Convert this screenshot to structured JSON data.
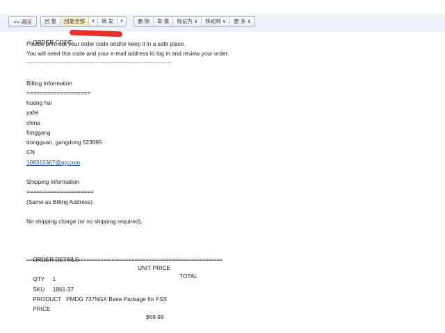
{
  "toolbar": {
    "back": "<< 返回",
    "reply": "回 复",
    "reply_all": "回复全部",
    "forward": "转 发",
    "delete": "删 除",
    "report": "举 报",
    "mark_as": "标记为",
    "move_to": "移动到",
    "more": "更 多",
    "dropdown_arrow": "∨"
  },
  "email": {
    "order_code_label": "ORDER CODE:",
    "instructions_1": "Please print out your order code and/or keep it in a safe place.",
    "instructions_2": "You will need this code and your e-mail address to log in and review your order.",
    "divider_dash": "-----------------------------------------------------------------------------------------------",
    "billing": {
      "heading": "Billing Information",
      "underline": "===================",
      "name": "huang hui",
      "line2": "yafei",
      "line3": "china",
      "line4": "fonggang",
      "city_line": "dongguan, gangdong 523695",
      "country": "CN",
      "email": "108315367@qq.com"
    },
    "shipping": {
      "heading": "Shipping Information",
      "underline": "====================",
      "same_as": "(Same as Billing Address)",
      "charge_note": "No shipping charge (or no shipping required)."
    },
    "order_details": {
      "heading": "ORDER DETAILS",
      "unit_price_header": "UNIT PRICE",
      "total_header": "TOTAL",
      "divider_equals": "=====================================================================",
      "qty_label": "QTY",
      "qty_value": "1",
      "sku_label": "SKU",
      "sku_value": "1861-37",
      "product_label": "PRODUCT",
      "product_value": "PMDG 737NGX Base Package for FSX",
      "price_label": "PRICE",
      "price_value": "$69.99"
    }
  },
  "colors": {
    "toolbar_bg": "#eef4fa",
    "link": "#1a4ea7",
    "redaction": "#e8302a"
  }
}
